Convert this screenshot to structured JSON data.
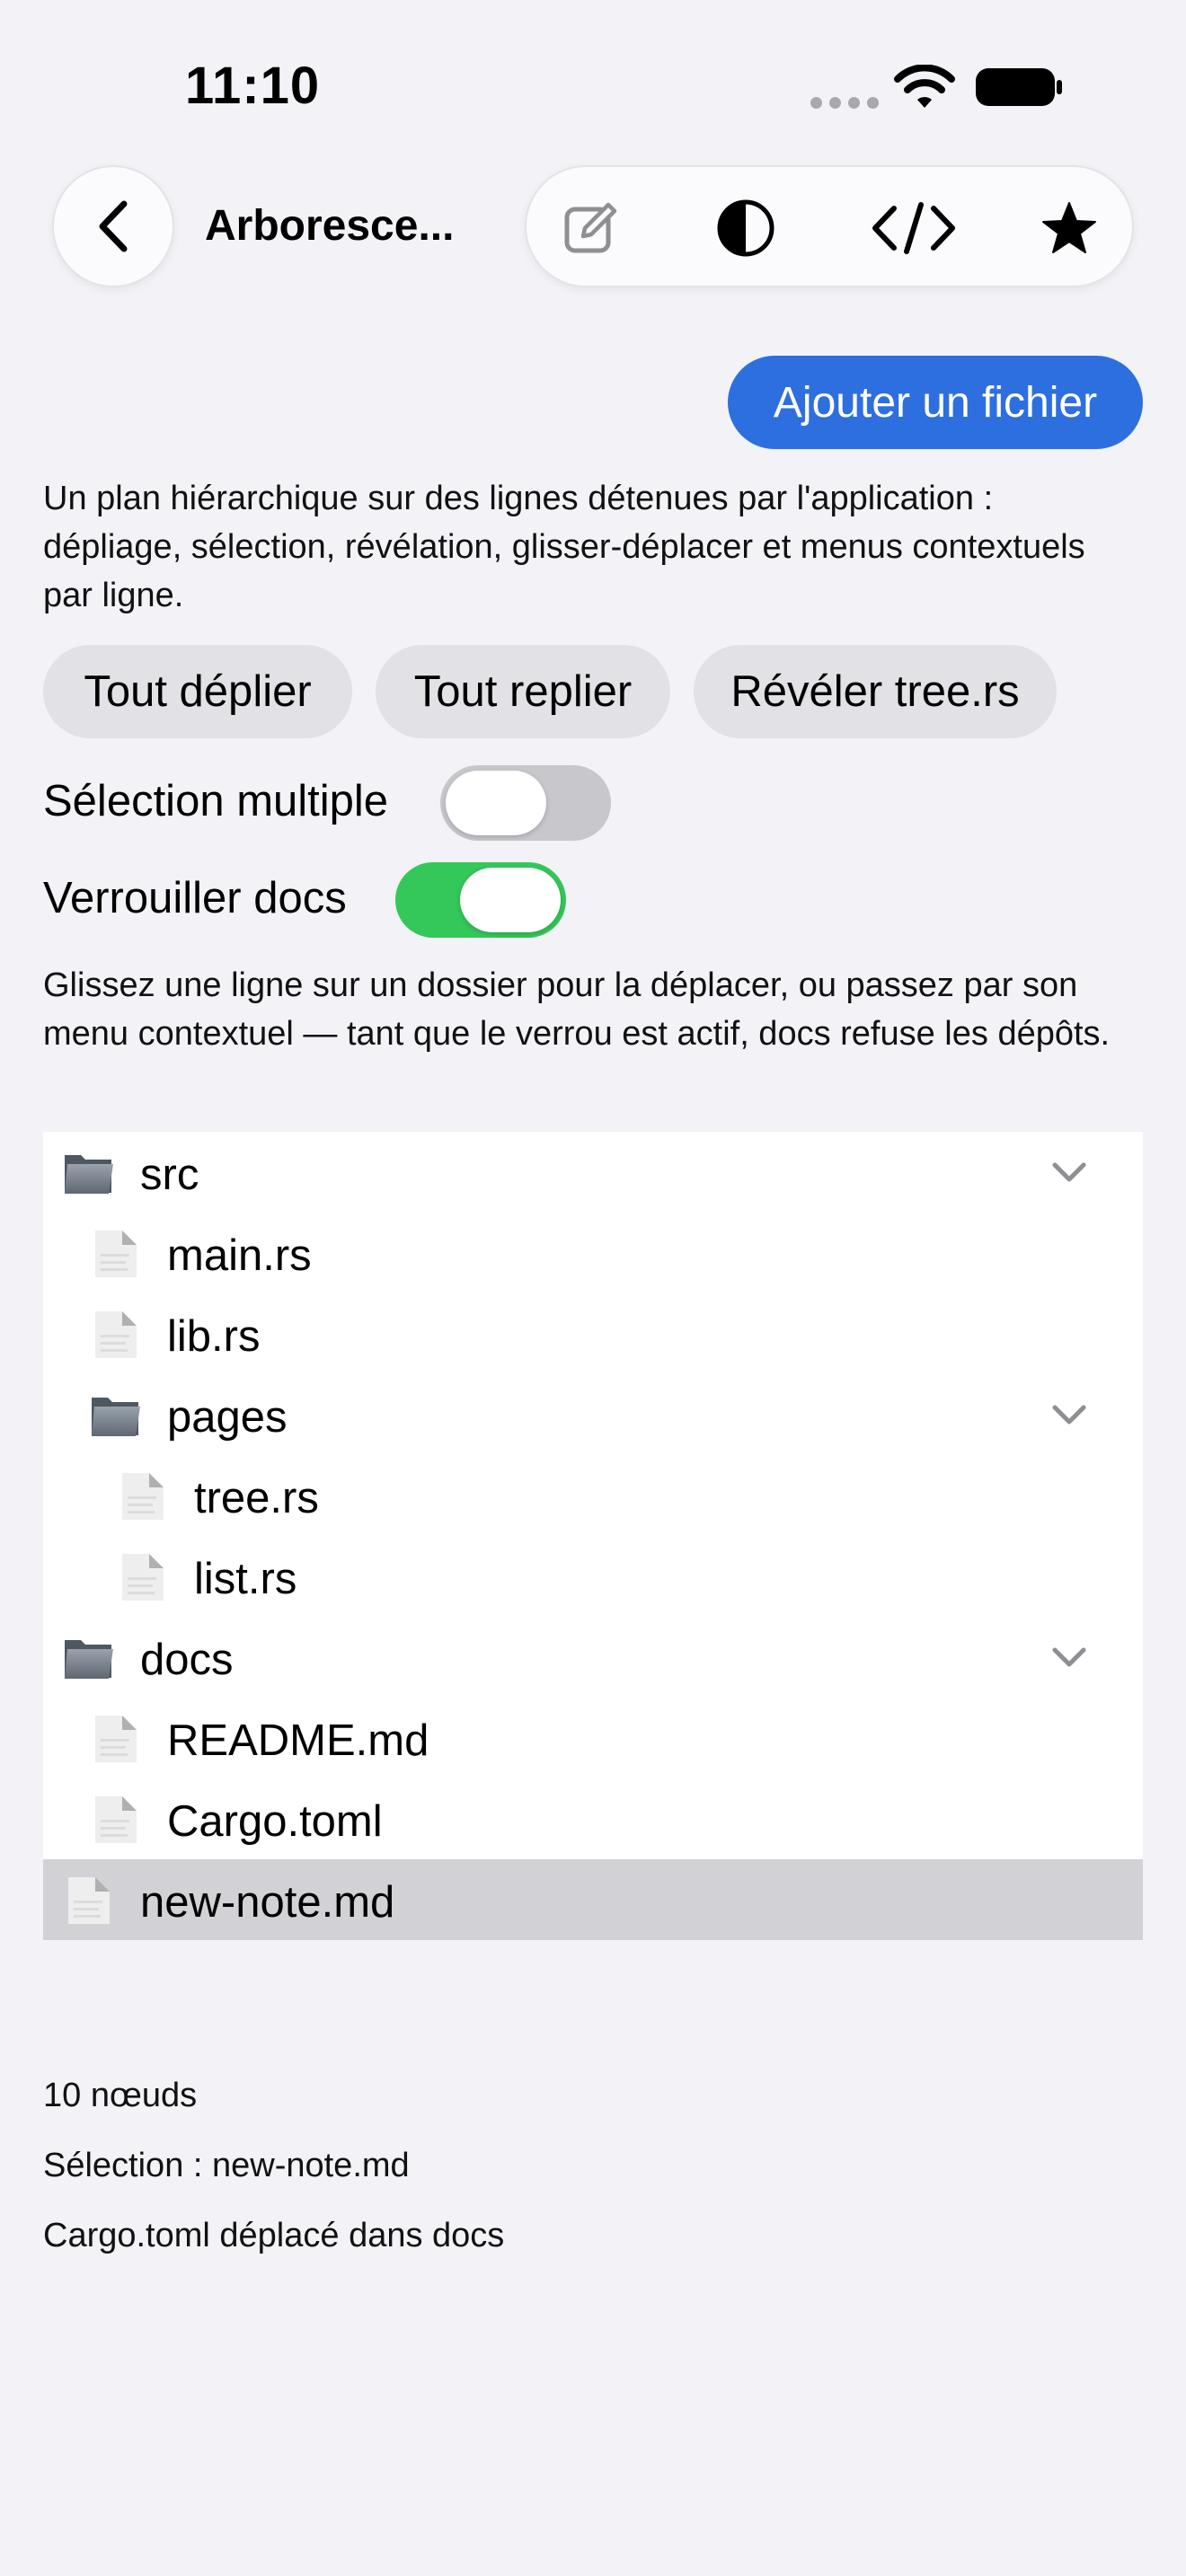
{
  "status_bar": {
    "time": "11:10"
  },
  "nav": {
    "title": "Arboresce...",
    "toolbar": [
      "edit-icon",
      "contrast-icon",
      "code-icon",
      "star-icon"
    ]
  },
  "add_file_label": "Ajouter un fichier",
  "description": "Un plan hiérarchique sur des lignes détenues par l'application : dépliage, sélection, révélation, glisser-déplacer et menus contextuels par ligne.",
  "actions": {
    "expand_all": "Tout déplier",
    "collapse_all": "Tout replier",
    "reveal": "Révéler tree.rs"
  },
  "toggles": {
    "multi_select": {
      "label": "Sélection multiple",
      "on": false
    },
    "lock_docs": {
      "label": "Verrouiller docs",
      "on": true
    }
  },
  "drag_hint": "Glissez une ligne sur un dossier pour la déplacer, ou passez par son menu contextuel — tant que le verrou est actif, docs refuse les dépôts.",
  "tree": {
    "rows": [
      {
        "label": "src",
        "kind": "folder",
        "depth": 0,
        "expanded": true
      },
      {
        "label": "main.rs",
        "kind": "file",
        "depth": 1
      },
      {
        "label": "lib.rs",
        "kind": "file",
        "depth": 1
      },
      {
        "label": "pages",
        "kind": "folder",
        "depth": 1,
        "expanded": true
      },
      {
        "label": "tree.rs",
        "kind": "file",
        "depth": 2
      },
      {
        "label": "list.rs",
        "kind": "file",
        "depth": 2
      },
      {
        "label": "docs",
        "kind": "folder",
        "depth": 0,
        "expanded": true
      },
      {
        "label": "README.md",
        "kind": "file",
        "depth": 1
      },
      {
        "label": "Cargo.toml",
        "kind": "file",
        "depth": 1
      },
      {
        "label": "new-note.md",
        "kind": "file",
        "depth": 0,
        "selected": true
      }
    ]
  },
  "footer": {
    "node_count": "10 nœuds",
    "selection": "Sélection : new-note.md",
    "last_move": "Cargo.toml déplacé dans docs"
  },
  "colors": {
    "accent": "#2e6fe0",
    "toggle_on": "#34c759",
    "toggle_off": "#c7c7cc",
    "selected_row": "#d1d1d6",
    "background": "#f2f2f7"
  }
}
